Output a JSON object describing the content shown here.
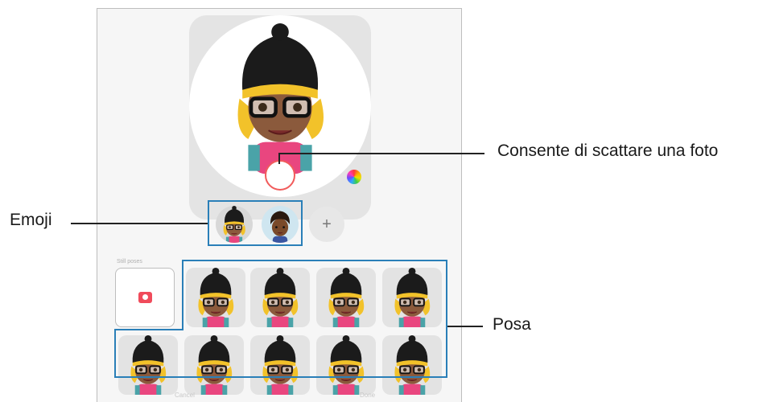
{
  "callouts": {
    "shutter": "Consente di scattare una foto",
    "emoji": "Emoji",
    "pose": "Posa"
  },
  "screen": {
    "section_label": "Still poses",
    "add_button": "+",
    "bottom_left": "Cancel",
    "bottom_right": "Done"
  },
  "icons": {
    "shutter": "shutter-icon",
    "color": "color-palette-icon",
    "camera": "camera-icon",
    "add": "plus-icon"
  },
  "colors": {
    "highlight": "#2a7fb8",
    "shutter_ring": "#f15b5b",
    "camera_icon": "#f04b5b",
    "beanie": "#1b1b1b",
    "hair": "#f2c22a",
    "skin": "#8b5a3c",
    "shirt": "#e9467f"
  }
}
